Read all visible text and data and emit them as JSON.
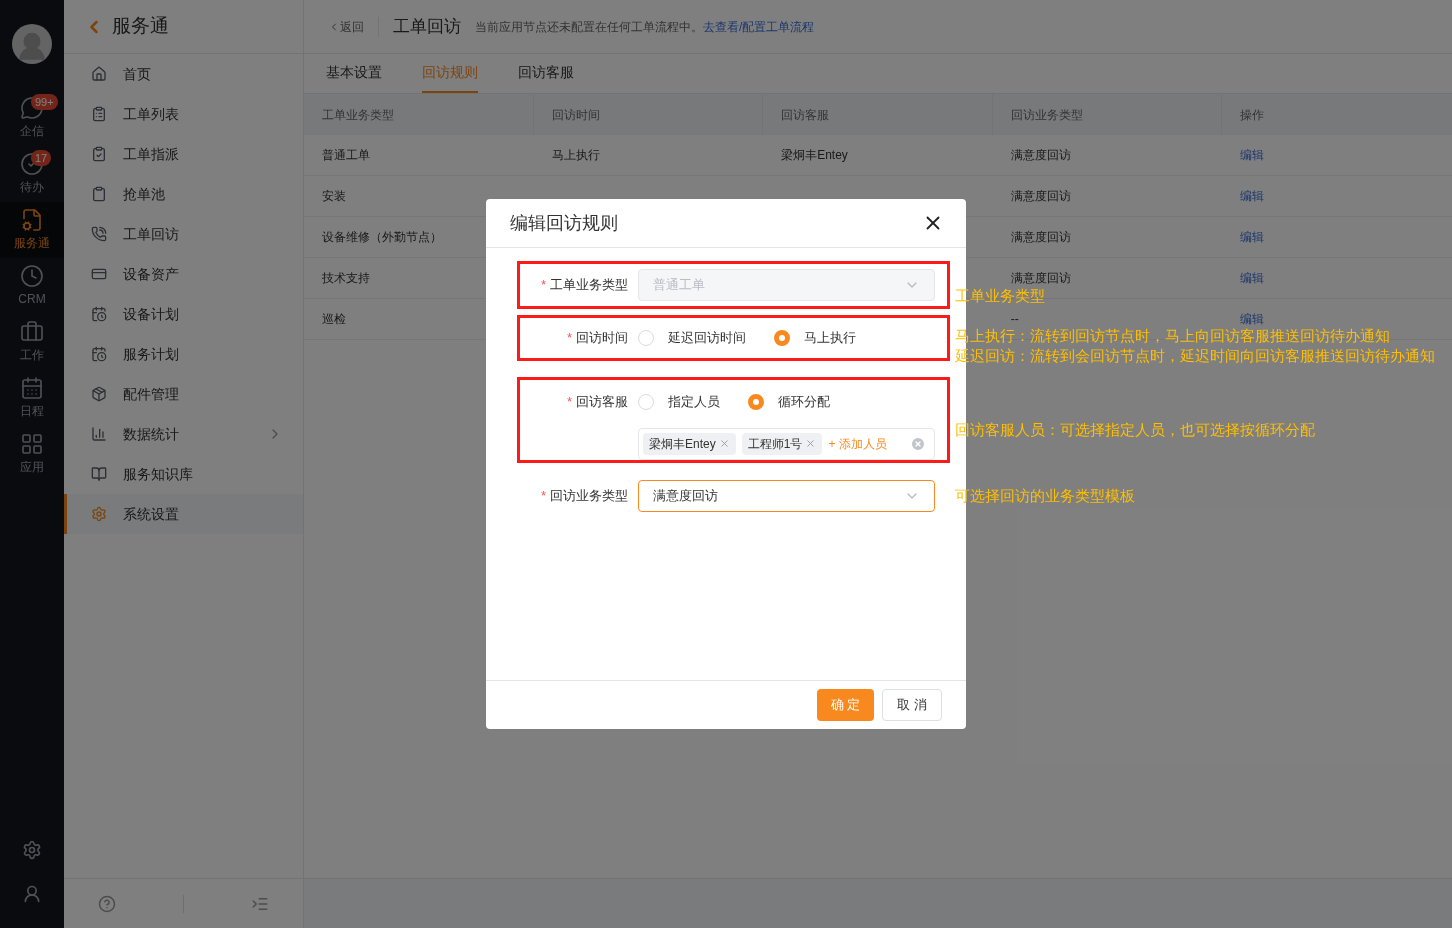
{
  "rail": {
    "items": [
      {
        "label": "企信",
        "badge": "99+",
        "selected": false
      },
      {
        "label": "待办",
        "badge": "17",
        "selected": false
      },
      {
        "label": "服务通",
        "selected": true
      },
      {
        "label": "CRM",
        "selected": false
      },
      {
        "label": "工作",
        "selected": false
      },
      {
        "label": "日程",
        "selected": false
      },
      {
        "label": "应用",
        "selected": false
      }
    ]
  },
  "sidebar": {
    "title": "服务通",
    "items": [
      {
        "label": "首页",
        "selected": false
      },
      {
        "label": "工单列表",
        "selected": false
      },
      {
        "label": "工单指派",
        "selected": false
      },
      {
        "label": "抢单池",
        "selected": false
      },
      {
        "label": "工单回访",
        "selected": false
      },
      {
        "label": "设备资产",
        "selected": false
      },
      {
        "label": "设备计划",
        "selected": false
      },
      {
        "label": "服务计划",
        "selected": false
      },
      {
        "label": "配件管理",
        "selected": false
      },
      {
        "label": "数据统计",
        "selected": false,
        "has_submenu": true
      },
      {
        "label": "服务知识库",
        "selected": false
      },
      {
        "label": "系统设置",
        "selected": true
      }
    ]
  },
  "header": {
    "back": "返回",
    "title": "工单回访",
    "hint": "当前应用节点还未配置在任何工单流程中。",
    "link": "去查看/配置工单流程"
  },
  "tabs": [
    {
      "label": "基本设置",
      "selected": false
    },
    {
      "label": "回访规则",
      "selected": true
    },
    {
      "label": "回访客服",
      "selected": false
    }
  ],
  "table": {
    "columns": [
      "工单业务类型",
      "回访时间",
      "回访客服",
      "回访业务类型",
      "操作"
    ],
    "rows": [
      {
        "cells": [
          "普通工单",
          "马上执行",
          "梁炯丰Entey",
          "满意度回访",
          "编辑"
        ]
      },
      {
        "cells": [
          "安装",
          null,
          null,
          "满意度回访",
          "编辑"
        ]
      },
      {
        "cells": [
          "设备维修（外勤节点）",
          null,
          null,
          "满意度回访",
          "编辑"
        ]
      },
      {
        "cells": [
          "技术支持",
          null,
          null,
          "满意度回访",
          "编辑"
        ]
      },
      {
        "cells": [
          "巡检",
          null,
          null,
          "--",
          "编辑"
        ]
      }
    ]
  },
  "dialog": {
    "title": "编辑回访规则",
    "fields": [
      {
        "kind": "select",
        "required_mark": "*",
        "label": "工单业务类型",
        "value": "普通工单",
        "disabled": true,
        "highlighted": true
      },
      {
        "kind": "radio",
        "required_mark": "*",
        "label": "回访时间",
        "options": [
          {
            "label": "延迟回访时间",
            "selected": false
          },
          {
            "label": "马上执行",
            "selected": true
          }
        ],
        "highlighted": true
      },
      {
        "kind": "radio",
        "required_mark": "*",
        "label": "回访客服",
        "options": [
          {
            "label": "指定人员",
            "selected": false
          },
          {
            "label": "循环分配",
            "selected": true
          }
        ],
        "tags": [
          "梁炯丰Entey",
          "工程师1号"
        ],
        "add_label": "+ 添加人员",
        "highlighted": true
      },
      {
        "kind": "select",
        "required_mark": "*",
        "label": "回访业务类型",
        "value": "满意度回访",
        "disabled": false,
        "highlighted": false
      }
    ],
    "buttons": [
      {
        "label": "确 定",
        "kind": "primary"
      },
      {
        "label": "取 消",
        "kind": "default"
      }
    ]
  },
  "notes": [
    {
      "lines": [
        "工单业务类型"
      ]
    },
    {
      "lines": [
        "马上执行：流转到回访节点时，马上向回访客服推送回访待办通知",
        "延迟回访：流转到会回访节点时，延迟时间向回访客服推送回访待办通知"
      ]
    },
    {
      "lines": [
        "回访客服人员：可选择指定人员，也可选择按循环分配"
      ]
    },
    {
      "lines": [
        "可选择回访的业务类型模板"
      ]
    }
  ]
}
